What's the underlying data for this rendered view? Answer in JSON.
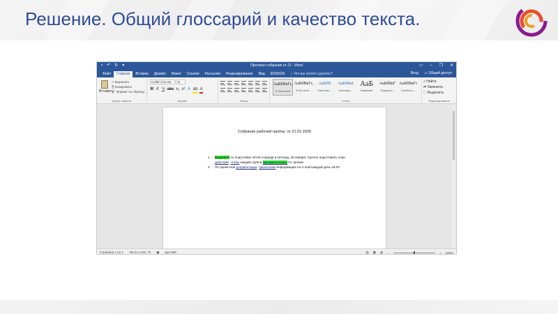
{
  "slide": {
    "title": "Решение. Общий глоссарий и качество текста."
  },
  "colors": {
    "title": "#2f4b9a",
    "word_blue": "#2b579a",
    "highlight": "#33e633"
  },
  "word": {
    "window_title": "Протокол собрания  от 21 - Word",
    "tabs": [
      "Файл",
      "Главная",
      "Вставка",
      "Дизайн",
      "Макет",
      "Ссылки",
      "Рассылки",
      "Рецензирование",
      "Вид",
      "EDISIGN"
    ],
    "active_tab": "Главная",
    "tell_me": "Что вы хотите сделать?",
    "sign_in": "Вход",
    "share": "Общий доступ",
    "clipboard": {
      "paste": "Вставить",
      "cut": "Вырезать",
      "copy": "Копировать",
      "format_painter": "Формат по образцу",
      "label": "Буфер обмена"
    },
    "font": {
      "name": "Calibri (Основ",
      "size": "11",
      "label": "Шрифт"
    },
    "paragraph_label": "Абзац",
    "styles": {
      "label": "Стили",
      "items": [
        {
          "sample": "АаБбВвГг,",
          "name": "¶ Обычный"
        },
        {
          "sample": "АаБбВвГг,",
          "name": "¶ Без инте..."
        },
        {
          "sample": "АаБбВ",
          "name": "Заголово..."
        },
        {
          "sample": "АаБбВвІ",
          "name": "Заголово..."
        },
        {
          "sample": "АаБ",
          "name": "Название"
        },
        {
          "sample": "АаБбВвГ",
          "name": "Подзагол..."
        },
        {
          "sample": "АаБбВвГг",
          "name": "Слабое в..."
        }
      ]
    },
    "editing": {
      "find": "Найти",
      "replace": "Заменить",
      "select": "Выделить",
      "label": "Редактирование"
    },
    "document": {
      "heading": "Собрание рабочей группы:   от 21.01.2020",
      "items": [
        {
          "num": "1.",
          "hl1": "Выделить",
          "text1": " по подготовке пятой очереди в пятницу, 26 января. Срочно подготовить план",
          "ul1": "действий",
          "ul2": "чтобы",
          "text2": " каждая группа ",
          "hl2": "закомментилась",
          "text3": " по  срокам."
        },
        {
          "num": "2.",
          "text1": "По проектной ",
          "ul1": "документации",
          "ul2": "присылаем",
          "text2": " информацию по e-mail каждый день 18.00"
        }
      ]
    },
    "status": {
      "page": "Страница 1 из 1",
      "words": "Число слов: 76",
      "language": "русский",
      "zoom": "100%"
    }
  }
}
